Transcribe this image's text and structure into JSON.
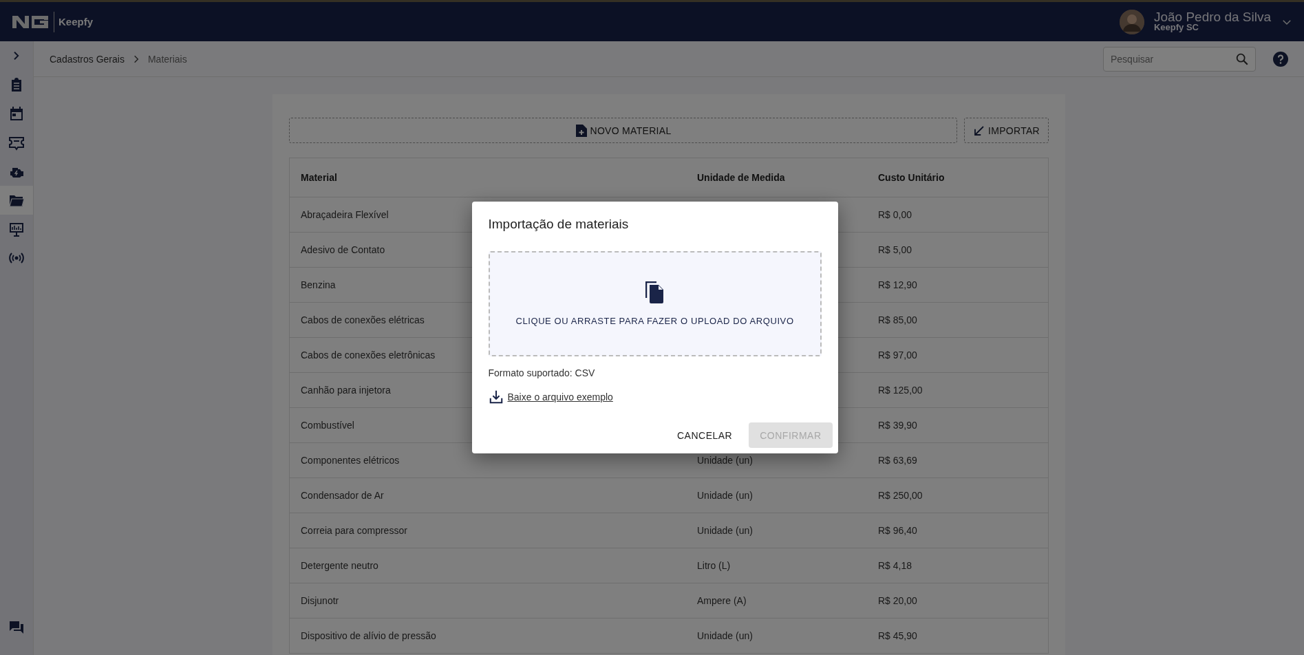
{
  "header": {
    "brand": "Keepfy",
    "user_name": "João Pedro da Silva",
    "user_company": "Keepfy SC"
  },
  "sidebar": {
    "items": [
      {
        "kind": "clipboard",
        "selected": false
      },
      {
        "kind": "calendar",
        "selected": false
      },
      {
        "kind": "ticket",
        "selected": false
      },
      {
        "kind": "engine",
        "selected": false
      },
      {
        "kind": "folder",
        "selected": true
      },
      {
        "kind": "monitor",
        "selected": false
      },
      {
        "kind": "broadcast",
        "selected": false
      }
    ]
  },
  "breadcrumb": [
    "Cadastros Gerais",
    "Materiais"
  ],
  "search": {
    "placeholder": "Pesquisar"
  },
  "toolbar": {
    "new_button": "NOVO MATERIAL",
    "import_button": "IMPORTAR"
  },
  "table": {
    "columns": [
      "Material",
      "Unidade de Medida",
      "Custo Unitário"
    ],
    "rows": [
      {
        "material": "Abraçadeira Flexível",
        "cost": "R$ 0,00"
      },
      {
        "material": "Adesivo de Contato",
        "cost": "R$ 5,00"
      },
      {
        "material": "Benzina",
        "cost": "R$ 12,90"
      },
      {
        "material": "Cabos de conexões elétricas",
        "cost": "R$ 85,00"
      },
      {
        "material": "Cabos de conexões eletrônicas",
        "cost": "R$ 97,00"
      },
      {
        "material": "Canhão para injetora",
        "cost": "R$ 125,00"
      },
      {
        "material": "Combustível",
        "cost": "R$ 39,90"
      },
      {
        "material": "Componentes elétricos",
        "unit": "Unidade (un)",
        "cost": "R$ 63,69"
      },
      {
        "material": "Condensador de Ar",
        "unit": "Unidade (un)",
        "cost": "R$ 250,00"
      },
      {
        "material": "Correia para compressor",
        "unit": "Unidade (un)",
        "cost": "R$ 96,40"
      },
      {
        "material": "Detergente neutro",
        "unit": "Litro (L)",
        "cost": "R$ 4,18"
      },
      {
        "material": "Disjunotr",
        "unit": "Ampere (A)",
        "cost": "R$ 20,00"
      },
      {
        "material": "Dispositivo de alívio de pressão",
        "unit": "Unidade (un)",
        "cost": "R$ 45,90"
      }
    ]
  },
  "dialog": {
    "title": "Importação de materiais",
    "dropzone": "CLIQUE OU ARRASTE PARA FAZER O UPLOAD DO ARQUIVO",
    "format_note": "Formato suportado: CSV",
    "example_link": "Baixe o arquivo exemplo",
    "cancel": "CANCELAR",
    "confirm": "CONFIRMAR",
    "confirm_disabled": true
  }
}
